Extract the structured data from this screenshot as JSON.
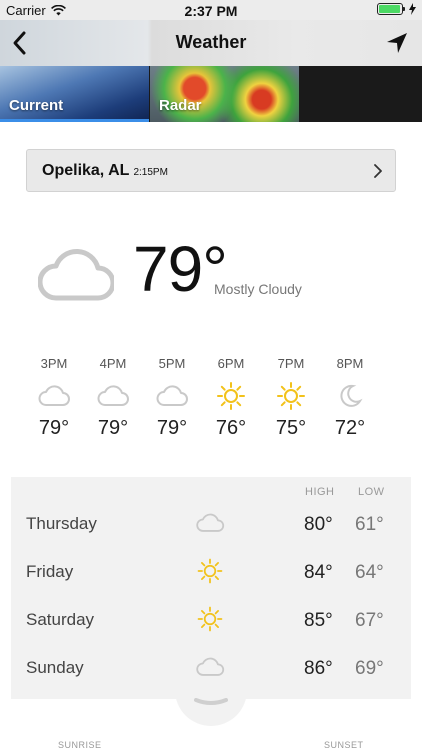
{
  "status_bar": {
    "carrier": "Carrier",
    "time": "2:37 PM",
    "battery_level": 0.95
  },
  "nav": {
    "title": "Weather"
  },
  "tabs": [
    {
      "label": "Current",
      "selected": true
    },
    {
      "label": "Radar",
      "selected": false
    }
  ],
  "location": {
    "city": "Opelika, AL",
    "time": "2:15PM"
  },
  "current": {
    "temp": "79°",
    "condition": "Mostly Cloudy",
    "icon": "cloud-icon"
  },
  "hourly": [
    {
      "label": "3PM",
      "icon": "cloud-icon",
      "temp": "79°"
    },
    {
      "label": "4PM",
      "icon": "cloud-icon",
      "temp": "79°"
    },
    {
      "label": "5PM",
      "icon": "cloud-icon",
      "temp": "79°"
    },
    {
      "label": "6PM",
      "icon": "sun-icon",
      "temp": "76°"
    },
    {
      "label": "7PM",
      "icon": "sun-icon",
      "temp": "75°"
    },
    {
      "label": "8PM",
      "icon": "moon-icon",
      "temp": "72°"
    }
  ],
  "daily": {
    "high_label": "HIGH",
    "low_label": "LOW",
    "days": [
      {
        "day": "Thursday",
        "icon": "cloud-icon",
        "high": "80°",
        "low": "61°"
      },
      {
        "day": "Friday",
        "icon": "sun-icon",
        "high": "84°",
        "low": "64°"
      },
      {
        "day": "Saturday",
        "icon": "sun-icon",
        "high": "85°",
        "low": "67°"
      },
      {
        "day": "Sunday",
        "icon": "cloud-icon",
        "high": "86°",
        "low": "69°"
      }
    ]
  },
  "footer": {
    "sunrise_label": "SUNRISE",
    "sunset_label": "SUNSET"
  },
  "colors": {
    "accent": "#3b8ee8",
    "sun": "#f2c21b",
    "cloud": "#c9c9c9",
    "battery": "#4cd964"
  }
}
